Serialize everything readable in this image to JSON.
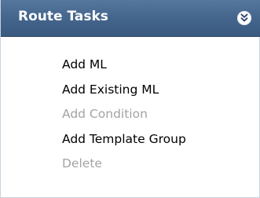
{
  "panel": {
    "title": "Route Tasks",
    "toggle_icon": "double-chevron-down-icon",
    "header_color": "#44658c",
    "items": [
      {
        "label": "Add ML",
        "enabled": true
      },
      {
        "label": "Add Existing ML",
        "enabled": true
      },
      {
        "label": "Add Condition",
        "enabled": false
      },
      {
        "label": "Add Template Group",
        "enabled": true
      },
      {
        "label": "Delete",
        "enabled": false
      }
    ]
  }
}
